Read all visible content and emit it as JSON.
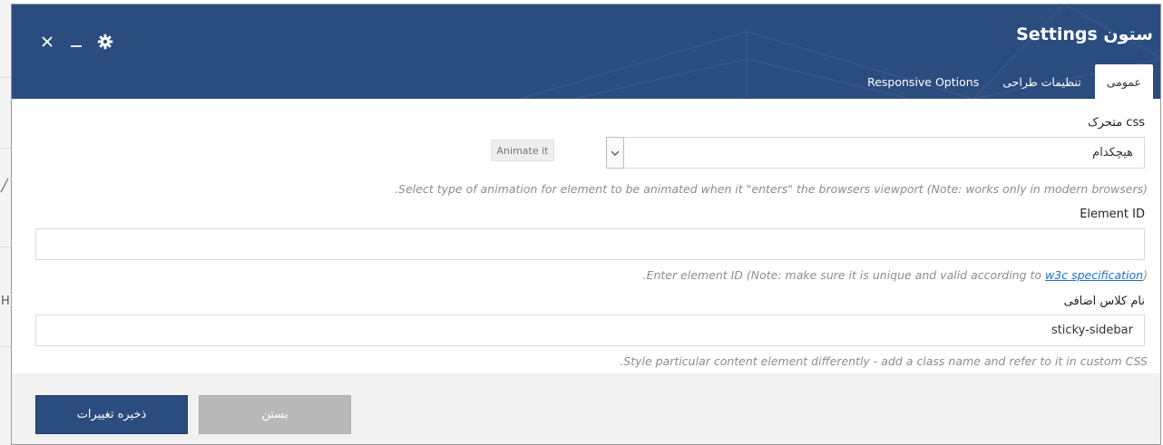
{
  "modal": {
    "title": "ستون Settings",
    "tabs": [
      {
        "label": "عمومی",
        "active": true
      },
      {
        "label": "تنظیمات طراحی",
        "active": false
      },
      {
        "label": "Responsive Options",
        "active": false
      }
    ],
    "controls": {
      "close": "close-icon",
      "minimize": "minimize-icon",
      "settings": "gear-icon"
    }
  },
  "fields": {
    "css_animation": {
      "label": "css متحرک",
      "selected": "هیچکدام",
      "animate_button": "Animate it",
      "help": ".Select type of animation for element to be animated when it \"enters\" the browsers viewport (Note: works only in modern browsers)"
    },
    "element_id": {
      "label": "Element ID",
      "value": "",
      "help_prefix": ".Enter element ID (Note: make sure it is unique and valid according to ",
      "help_link": "w3c specification",
      "help_suffix": ")"
    },
    "extra_class": {
      "label": "نام کلاس اضافی",
      "value": "sticky-sidebar",
      "help": ".Style particular content element differently - add a class name and refer to it in custom CSS"
    }
  },
  "footer": {
    "save_label": "ذخیره تغییرات",
    "close_label": "بستن"
  },
  "colors": {
    "header": "#2b4c7f",
    "save_button": "#2b4c7f",
    "close_button": "#b9b9b9",
    "link": "#1f6fc5"
  }
}
